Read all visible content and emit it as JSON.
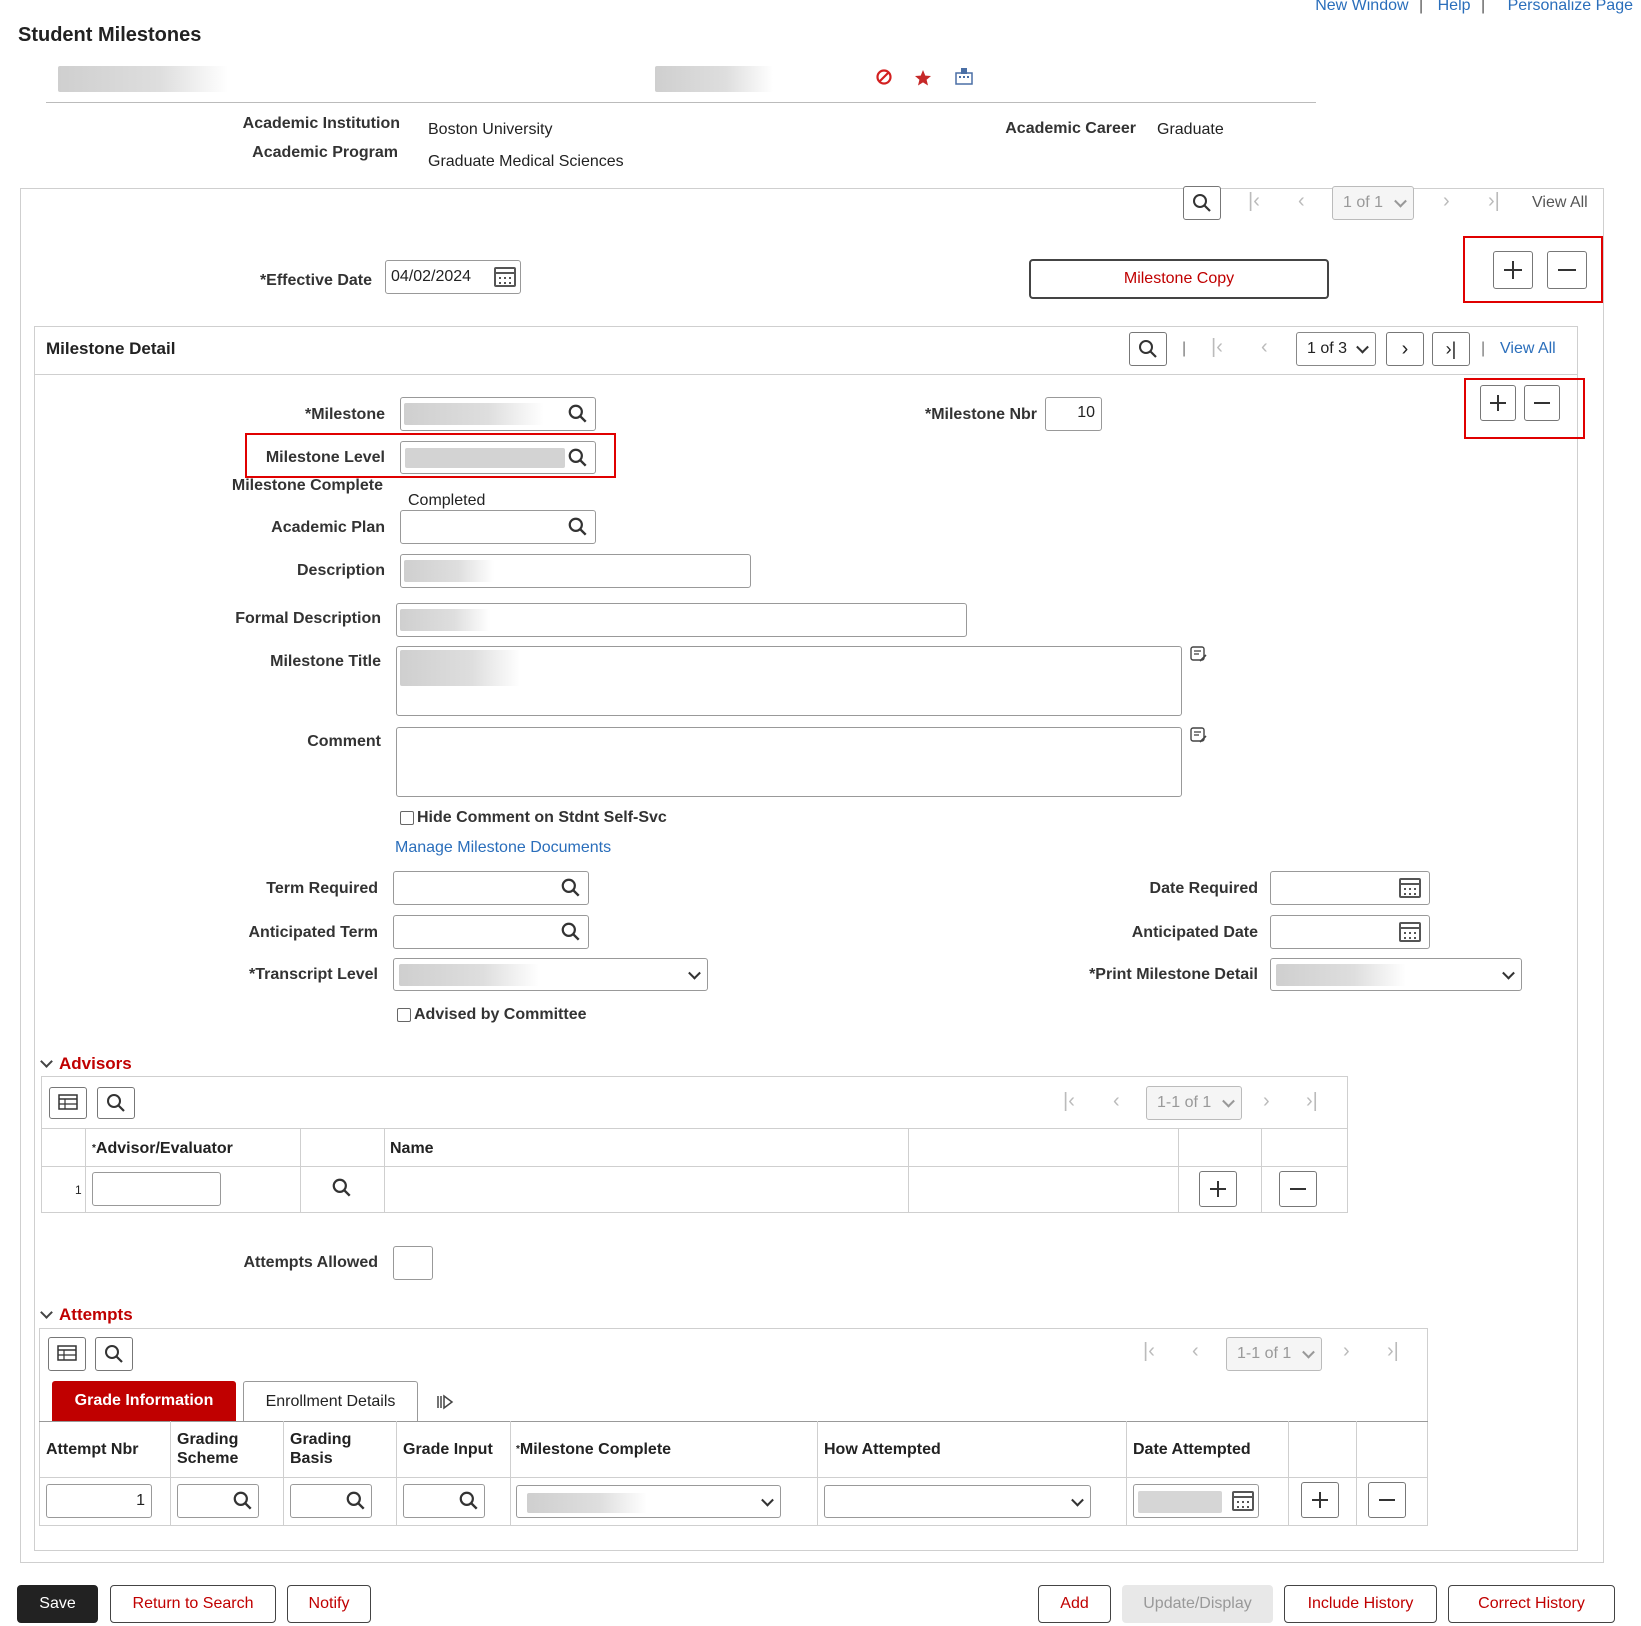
{
  "top_links": {
    "new_window": "New Window",
    "help": "Help",
    "personalize": "Personalize Page",
    "sep": "|"
  },
  "page_title": "Student Milestones",
  "header": {
    "institution_label": "Academic Institution",
    "institution_value": "Boston University",
    "program_label": "Academic Program",
    "program_value": "Graduate Medical Sciences",
    "career_label": "Academic Career",
    "career_value": "Graduate"
  },
  "outer_pager": {
    "text": "1 of 1",
    "view_all": "View All"
  },
  "effective_date": {
    "label": "*Effective Date",
    "value": "04/02/2024"
  },
  "milestone_copy_label": "Milestone Copy",
  "milestone_detail": {
    "title": "Milestone Detail",
    "pager_text": "1 of 3",
    "view_all": "View All",
    "sep": "|",
    "milestone_label": "*Milestone",
    "milestone_nbr_label": "*Milestone Nbr",
    "milestone_nbr_value": "10",
    "milestone_level_label": "Milestone Level",
    "milestone_complete_label": "Milestone Complete",
    "milestone_complete_value": "Completed",
    "academic_plan_label": "Academic Plan",
    "description_label": "Description",
    "formal_description_label": "Formal Description",
    "milestone_title_label": "Milestone Title",
    "comment_label": "Comment",
    "hide_comment_label": "Hide Comment on Stdnt Self-Svc",
    "manage_docs_link": "Manage Milestone Documents",
    "term_required_label": "Term Required",
    "anticipated_term_label": "Anticipated Term",
    "transcript_level_label": "*Transcript Level",
    "date_required_label": "Date Required",
    "anticipated_date_label": "Anticipated Date",
    "print_detail_label": "*Print Milestone Detail",
    "advised_label": "Advised by Committee",
    "attempts_allowed_label": "Attempts Allowed"
  },
  "advisors": {
    "title": "Advisors",
    "pager_text": "1-1 of 1",
    "col_advisor": "Advisor/Evaluator",
    "col_name": "Name",
    "row_num": "1"
  },
  "attempts": {
    "title": "Attempts",
    "pager_text": "1-1 of 1",
    "tab_grade": "Grade Information",
    "tab_enroll": "Enrollment Details",
    "columns": [
      "Attempt Nbr",
      "Grading Scheme",
      "Grading Basis",
      "Grade Input",
      "Milestone Complete",
      "How Attempted",
      "Date Attempted"
    ],
    "row_attempt_nbr": "1"
  },
  "footer": {
    "save": "Save",
    "return_to_search": "Return to Search",
    "notify": "Notify",
    "add": "Add",
    "update_display": "Update/Display",
    "include_history": "Include History",
    "correct_history": "Correct History"
  },
  "colors": {
    "accent_red": "#c00000",
    "link_blue": "#2a6ebb",
    "highlight_red": "#e00000"
  },
  "icons": [
    "search-icon",
    "calendar-icon",
    "plus-icon",
    "minus-icon",
    "chevron-down-icon",
    "first-page-icon",
    "prev-page-icon",
    "next-page-icon",
    "last-page-icon",
    "grid-personalize-icon",
    "spellcheck-icon",
    "show-all-columns-icon",
    "no-entry-icon",
    "star-icon",
    "org-icon"
  ]
}
